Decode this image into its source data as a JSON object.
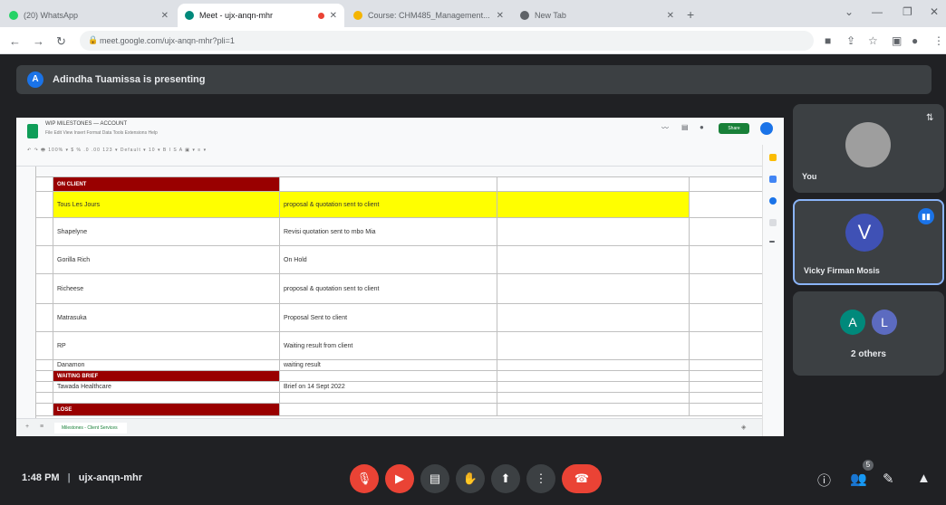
{
  "browser": {
    "tabs": [
      {
        "title": "(20) WhatsApp",
        "fav_color": "#25d366"
      },
      {
        "title": "Meet - ujx-anqn-mhr",
        "fav_color": "#00897b"
      },
      {
        "title": "Course: CHM485_Management...",
        "fav_color": "#f4b400"
      },
      {
        "title": "New Tab",
        "fav_color": "#5f6368"
      }
    ],
    "url": "meet.google.com/ujx-anqn-mhr?pli=1",
    "new_tab": "+",
    "close": "✕",
    "colors": {
      "tabbar": "#dee1e6",
      "recording_dot": "#ea4335"
    }
  },
  "meet": {
    "presenter_initial": "A",
    "presenting_text": "Adindha Tuamissa is presenting",
    "meeting_time": "1:48 PM",
    "meeting_code": "ujx-anqn-mhr",
    "tiles": {
      "you_label": "You",
      "vicky_initial": "V",
      "vicky_name": "Vicky Firman Mosis",
      "others_initials": [
        "A",
        "L"
      ],
      "others_label": "2 others"
    },
    "colors": {
      "bg": "#202124",
      "surface": "#3c4043",
      "danger": "#ea4335",
      "accent": "#1a73e8",
      "vicky_tile_border": "#8ab4f8"
    }
  },
  "sheet": {
    "title": "WIP MILESTONES — ACCOUNT",
    "menu": "File  Edit  View  Insert  Format  Data  Tools  Extensions  Help",
    "share_label": "Share",
    "tab_label": "Milestones - Client Services",
    "rows": [
      {
        "name": "ON CLIENT",
        "status": "",
        "style": "section"
      },
      {
        "name": "Tous Les Jours",
        "status": "proposal & quotation sent to client",
        "style": "highlight"
      },
      {
        "name": "Shapelyne",
        "status": "Revisi quotation sent to mbo Mia",
        "style": "normal"
      },
      {
        "name": "Gorilla Rich",
        "status": "On Hold",
        "style": "normal"
      },
      {
        "name": "Richeese",
        "status": "proposal & quotation sent to client",
        "style": "normal"
      },
      {
        "name": "Matrasuka",
        "status": "Proposal Sent to client",
        "style": "normal"
      },
      {
        "name": "RP",
        "status": "Waiting result from client",
        "style": "normal"
      },
      {
        "name": "Danamon",
        "status": "waiting result",
        "style": "normal"
      },
      {
        "name": "WAITING BRIEF",
        "status": "",
        "style": "section"
      },
      {
        "name": "Tawada Healthcare",
        "status": "Brief on 14 Sept 2022",
        "style": "normal"
      },
      {
        "name": "",
        "status": "",
        "style": "normal"
      },
      {
        "name": "LOSE",
        "status": "",
        "style": "section"
      }
    ],
    "colors": {
      "section": "#990000",
      "highlight": "#ffff00",
      "green": "#188038"
    }
  },
  "controls": {
    "mic": "mic-off-icon",
    "cam": "camera-off-icon",
    "captions": "captions-icon",
    "hand": "raise-hand-icon",
    "present": "present-icon",
    "more": "more-icon",
    "hangup": "hangup-icon",
    "participants_badge": "5"
  }
}
